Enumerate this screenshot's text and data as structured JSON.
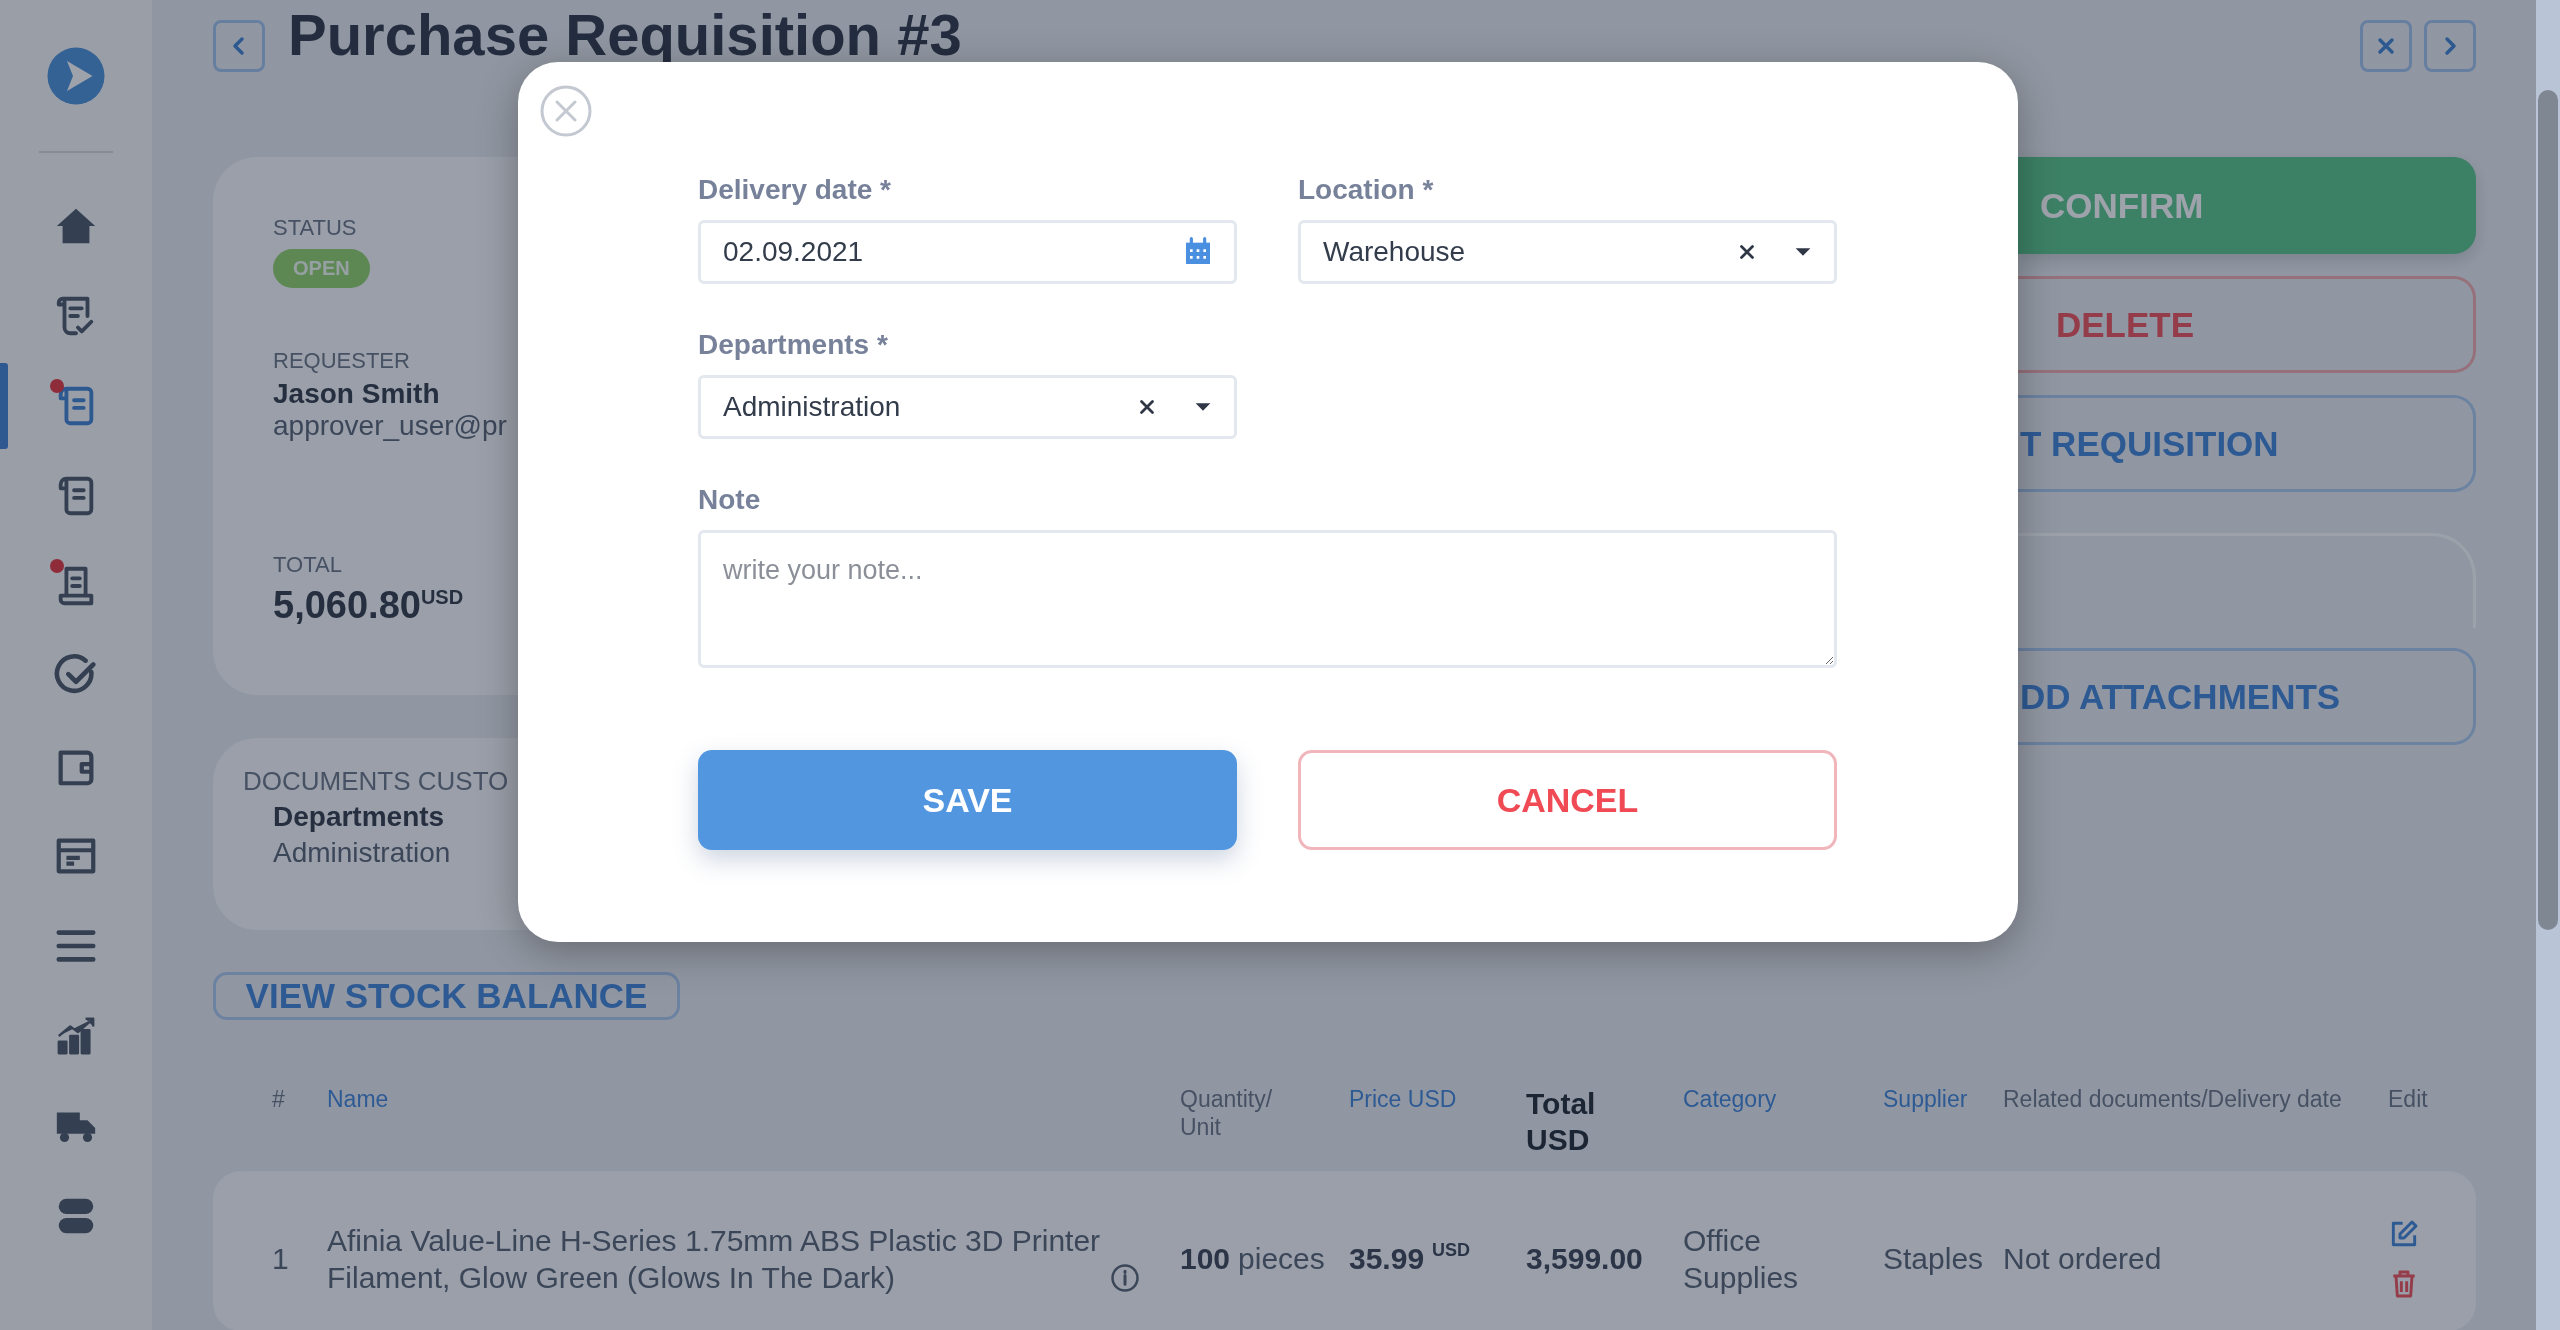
{
  "sidebar": {
    "items": [
      {
        "selected": false,
        "notification": false
      },
      {
        "selected": false,
        "notification": false
      },
      {
        "selected": true,
        "notification": true
      },
      {
        "selected": false,
        "notification": false
      },
      {
        "selected": false,
        "notification": true
      },
      {
        "selected": false,
        "notification": false
      },
      {
        "selected": false,
        "notification": false
      },
      {
        "selected": false,
        "notification": false
      },
      {
        "selected": false,
        "notification": false
      },
      {
        "selected": false,
        "notification": false
      },
      {
        "selected": false,
        "notification": false
      },
      {
        "selected": false,
        "notification": false
      }
    ]
  },
  "header": {
    "title": "Purchase Requisition #3"
  },
  "summary": {
    "status_label": "STATUS",
    "status": "OPEN",
    "requester_label": "REQUESTER",
    "requester_name": "Jason Smith",
    "requester_email": "approver_user@pr",
    "total_label": "TOTAL",
    "total": "5,060.80",
    "total_currency": "USD"
  },
  "custom_fields": {
    "title": "DOCUMENTS CUSTO",
    "fields": [
      {
        "label": "Departments",
        "value": "Administration"
      }
    ]
  },
  "actions": [
    {
      "kind": "primary",
      "label": "CONFIRM"
    },
    {
      "kind": "danger",
      "label": "DELETE"
    },
    {
      "kind": "outline",
      "label": "T REQUISITION"
    },
    {
      "kind": "panel"
    },
    {
      "kind": "outline",
      "label": "DD ATTACHMENTS"
    }
  ],
  "stock_button": "VIEW STOCK BALANCE",
  "table": {
    "columns": [
      {
        "label": "#",
        "kind": "plain"
      },
      {
        "label": "Name",
        "kind": "sortable"
      },
      {
        "label": "Quantity/ Unit",
        "kind": "plain"
      },
      {
        "label": "Price USD",
        "kind": "sortable"
      },
      {
        "label": "Total USD",
        "kind": "emphasized"
      },
      {
        "label": "Category",
        "kind": "sortable"
      },
      {
        "label": "Supplier",
        "kind": "sortable"
      },
      {
        "label": "Related documents/Delivery date",
        "kind": "plain"
      },
      {
        "label": "Edit",
        "kind": "plain"
      }
    ],
    "rows": [
      {
        "number": "1",
        "name": "Afinia Value-Line H-Series 1.75mm ABS Plastic 3D Printer Filament, Glow Green (Glows In The Dark)",
        "quantity": "100",
        "unit": "pieces",
        "price": "35.99",
        "price_currency": "USD",
        "total": "3,599.00",
        "category": "Office Supplies",
        "supplier": "Staples",
        "delivery": "Not ordered"
      }
    ]
  },
  "modal": {
    "fields": [
      {
        "kind": "date",
        "label": "Delivery date *",
        "value": "02.09.2021"
      },
      {
        "kind": "select",
        "label": "Location *",
        "value": "Warehouse"
      },
      {
        "kind": "select",
        "label": "Departments *",
        "value": "Administration"
      },
      {
        "kind": "textarea",
        "label": "Note",
        "placeholder": "write your note..."
      }
    ],
    "buttons": [
      {
        "kind": "primary",
        "label": "SAVE"
      },
      {
        "kind": "danger",
        "label": "CANCEL"
      }
    ]
  }
}
